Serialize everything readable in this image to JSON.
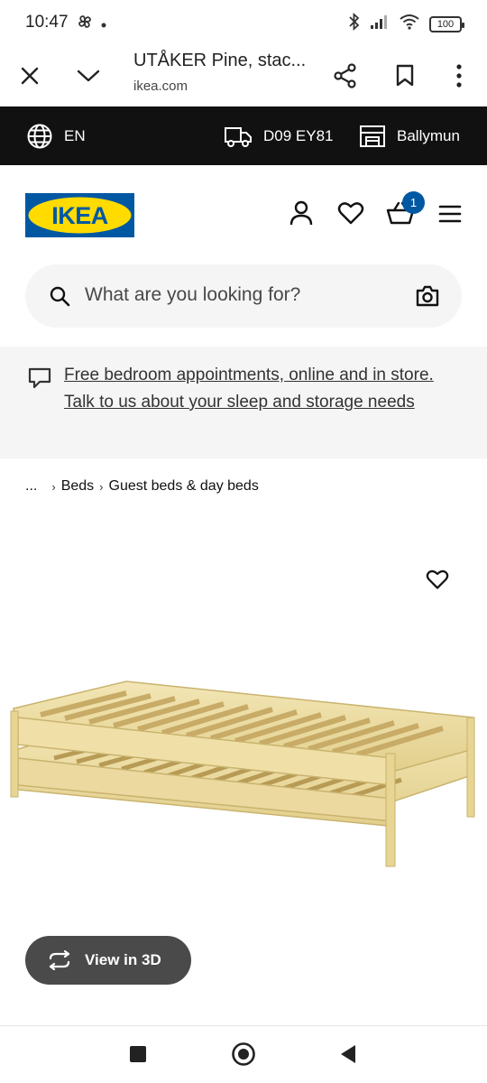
{
  "status": {
    "time": "10:47",
    "battery": "100"
  },
  "browser": {
    "title": "UTÅKER Pine, stac...",
    "domain": "ikea.com"
  },
  "locale_bar": {
    "language": "EN",
    "postcode": "D09 EY81",
    "store": "Ballymun"
  },
  "header": {
    "logo_text": "IKEA",
    "cart_count": "1"
  },
  "search": {
    "placeholder": "What are you looking for?"
  },
  "banner": {
    "text": "Free bedroom appointments, online and in store. Talk to us about your sleep and storage needs"
  },
  "breadcrumb": {
    "ellipsis": "...",
    "items": [
      "Beds",
      "Guest beds & day beds"
    ]
  },
  "product": {
    "view_3d_label": "View in 3D"
  },
  "colors": {
    "ikea_blue": "#0058a3",
    "ikea_yellow": "#ffdb00",
    "locale_bar_bg": "#111111",
    "banner_bg": "#f5f5f5",
    "view3d_bg": "#4a4a4a"
  }
}
